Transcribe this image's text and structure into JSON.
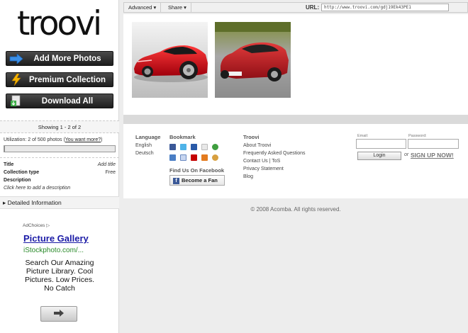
{
  "sidebar": {
    "logo": "troovi",
    "buttons": [
      {
        "label": "Add More Photos",
        "icon": "arrow-right-icon"
      },
      {
        "label": "Premium Collection",
        "icon": "lightning-icon"
      },
      {
        "label": "Download All",
        "icon": "download-icon"
      }
    ],
    "showing": "Showing 1 - 2 of 2",
    "utilization_text": "Utilization: 2 of 500 photos (",
    "utilization_link": "You want more?",
    "utilization_close": ")",
    "utilization_fraction": 0.004,
    "meta": [
      {
        "key": "Title",
        "value": "Add title"
      },
      {
        "key": "Collection type",
        "value": "Free"
      },
      {
        "key": "Description",
        "value": ""
      }
    ],
    "description_link": "Click here to add a description",
    "detailed_label": "Detailed Information"
  },
  "ad": {
    "choices": "AdChoices",
    "title": "Picture Gallery",
    "url": "iStockphoto.com/...",
    "body": "Search Our Amazing Picture Library. Cool Pictures. Low Prices. No Catch"
  },
  "topbar": {
    "advanced": "Advanced",
    "share": "Share",
    "url_label": "URL:",
    "url_value": "http://www.troovi.com/gdj19Ek43PE1"
  },
  "footer": {
    "language_heading": "Language",
    "languages": [
      "English",
      "Deutsch"
    ],
    "bookmark_heading": "Bookmark",
    "facebook_heading": "Find Us On Facebook",
    "fan_button": "Become a Fan",
    "troovi_heading": "Troovi",
    "troovi_links": [
      "About Troovi",
      "Frequently Asked Questions",
      "Contact Us | ToS",
      "Privacy Statement",
      "Blog"
    ],
    "email_label": "Email:",
    "password_label": "Password:",
    "login_button": "Login",
    "or": "or",
    "signup": "SIGN UP NOW!"
  },
  "copyright": "© 2008 Acomba. All rights reserved.",
  "colors": {
    "accent_blue": "#1a1aa6",
    "ad_green": "#2a8a2a",
    "car_red": "#c8102e"
  }
}
